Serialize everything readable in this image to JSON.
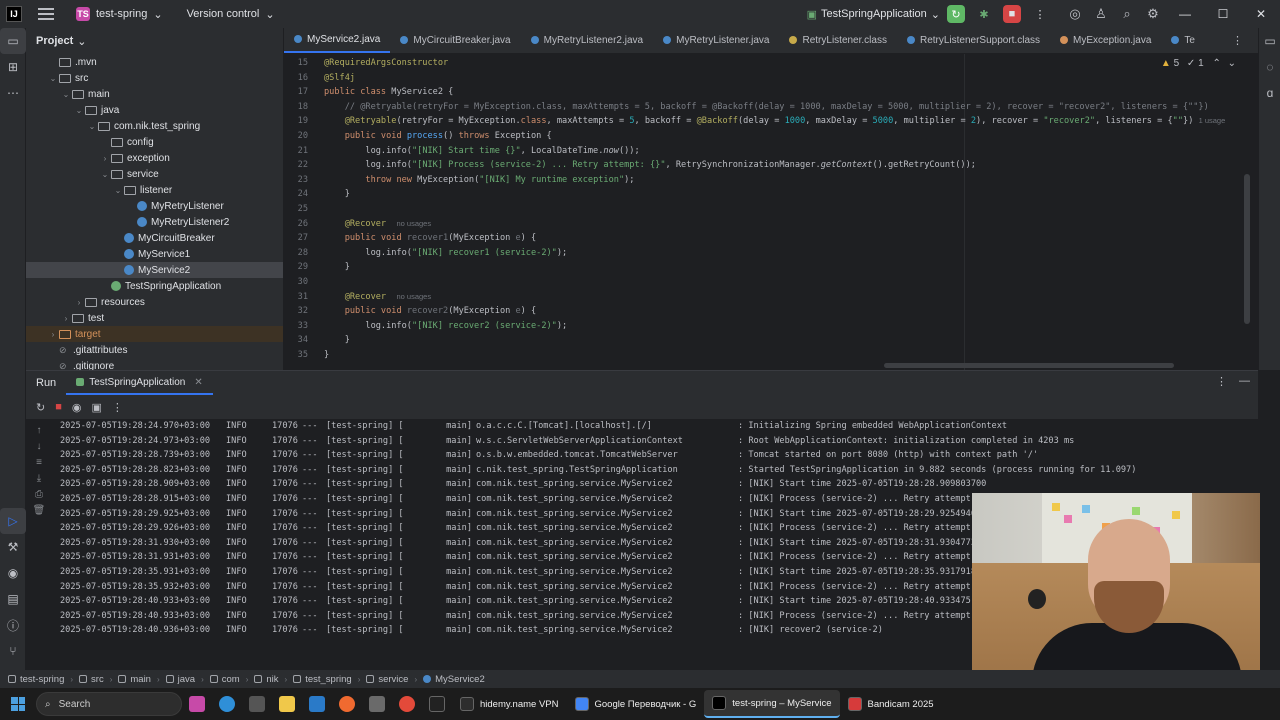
{
  "titlebar": {
    "logo": "IJ",
    "project_badge": "TS",
    "project_name": "test-spring",
    "vcs": "Version control",
    "run_config": "TestSpringApplication"
  },
  "project_panel": {
    "title": "Project",
    "items": [
      {
        "label": ".mvn",
        "indent": 1,
        "icon": "folder"
      },
      {
        "label": "src",
        "indent": 1,
        "icon": "folder",
        "expanded": true
      },
      {
        "label": "main",
        "indent": 2,
        "icon": "folder",
        "expanded": true
      },
      {
        "label": "java",
        "indent": 3,
        "icon": "folder",
        "expanded": true
      },
      {
        "label": "com.nik.test_spring",
        "indent": 4,
        "icon": "package",
        "expanded": true
      },
      {
        "label": "config",
        "indent": 5,
        "icon": "package"
      },
      {
        "label": "exception",
        "indent": 5,
        "icon": "package",
        "collapsed": true
      },
      {
        "label": "service",
        "indent": 5,
        "icon": "package",
        "expanded": true
      },
      {
        "label": "listener",
        "indent": 6,
        "icon": "package",
        "expanded": true
      },
      {
        "label": "MyRetryListener",
        "indent": 7,
        "icon": "class"
      },
      {
        "label": "MyRetryListener2",
        "indent": 7,
        "icon": "class"
      },
      {
        "label": "MyCircuitBreaker",
        "indent": 6,
        "icon": "class"
      },
      {
        "label": "MyService1",
        "indent": 6,
        "icon": "class"
      },
      {
        "label": "MyService2",
        "indent": 6,
        "icon": "class",
        "selected": true
      },
      {
        "label": "TestSpringApplication",
        "indent": 5,
        "icon": "spring"
      },
      {
        "label": "resources",
        "indent": 3,
        "icon": "folder",
        "collapsed": true
      },
      {
        "label": "test",
        "indent": 2,
        "icon": "folder",
        "collapsed": true
      },
      {
        "label": "target",
        "indent": 1,
        "icon": "folder-orange",
        "collapsed": true
      },
      {
        "label": ".gitattributes",
        "indent": 1,
        "icon": "file"
      },
      {
        "label": ".gitignore",
        "indent": 1,
        "icon": "file"
      }
    ]
  },
  "editor": {
    "tabs": [
      {
        "label": "MyService2.java",
        "active": true,
        "kind": "class"
      },
      {
        "label": "MyCircuitBreaker.java",
        "kind": "class"
      },
      {
        "label": "MyRetryListener2.java",
        "kind": "class"
      },
      {
        "label": "MyRetryListener.java",
        "kind": "class"
      },
      {
        "label": "RetryListener.class",
        "kind": "interface"
      },
      {
        "label": "RetryListenerSupport.class",
        "kind": "class"
      },
      {
        "label": "MyException.java",
        "kind": "exception"
      },
      {
        "label": "Te",
        "kind": "class"
      }
    ],
    "inspections": {
      "warnings": "5",
      "weak": "1"
    },
    "lines": [
      {
        "n": "15",
        "html": "<span class='ann'>@RequiredArgsConstructor</span>"
      },
      {
        "n": "16",
        "html": "<span class='ann'>@Slf4j</span>"
      },
      {
        "n": "17",
        "html": "<span class='kw'>public class</span> MyService2 {"
      },
      {
        "n": "18",
        "html": "    <span class='cmt'>// @Retryable(retryFor = MyException.class, maxAttempts = 5, backoff = @Backoff(delay = 1000, maxDelay = 5000, multiplier = 2), recover = \"recover2\", listeners = {\"\"})</span>"
      },
      {
        "n": "19",
        "html": "    <span class='ann'>@Retryable</span>(retryFor = MyException.<span class='kw'>class</span>, maxAttempts = <span class='num'>5</span>, backoff = <span class='ann'>@Backoff</span>(delay = <span class='num'>1000</span>, maxDelay = <span class='num'>5000</span>, multiplier = <span class='num'>2</span>), recover = <span class='str'>\"recover2\"</span>, listeners = {<span class='str'>\"\"</span>}) <span class='usage'>1 usage</span>"
      },
      {
        "n": "20",
        "html": "    <span class='kw'>public void</span> <span class='fn'>process</span>() <span class='kw'>throws</span> Exception {"
      },
      {
        "n": "21",
        "html": "        log.info(<span class='str'>\"[NIK] Start time {}\"</span>, LocalDateTime.<i>now</i>());"
      },
      {
        "n": "22",
        "html": "        log.info(<span class='str'>\"[NIK] Process (service-2) ... Retry attempt: {}\"</span>, RetrySynchronizationManager.<i>getContext</i>().getRetryCount());"
      },
      {
        "n": "23",
        "html": "        <span class='kw'>throw new</span> MyException(<span class='str'>\"[NIK] My runtime exception\"</span>);"
      },
      {
        "n": "24",
        "html": "    }"
      },
      {
        "n": "25",
        "html": ""
      },
      {
        "n": "26",
        "html": "    <span class='ann'>@Recover</span>  <span class='usage'>no usages</span>"
      },
      {
        "n": "27",
        "html": "    <span class='kw'>public void</span> <span class='grey'>recover1</span>(MyException <span class='grey'>e</span>) {"
      },
      {
        "n": "28",
        "html": "        log.info(<span class='str'>\"[NIK] recover1 (service-2)\"</span>);"
      },
      {
        "n": "29",
        "html": "    }"
      },
      {
        "n": "30",
        "html": ""
      },
      {
        "n": "31",
        "html": "    <span class='ann'>@Recover</span>  <span class='usage'>no usages</span>"
      },
      {
        "n": "32",
        "html": "    <span class='kw'>public void</span> <span class='grey'>recover2</span>(MyException <span class='grey'>e</span>) {"
      },
      {
        "n": "33",
        "html": "        log.info(<span class='str'>\"[NIK] recover2 (service-2)\"</span>);"
      },
      {
        "n": "34",
        "html": "    }"
      },
      {
        "n": "35",
        "html": "}"
      }
    ]
  },
  "run_panel": {
    "title": "Run",
    "tab": "TestSpringApplication",
    "logs": [
      {
        "ts": "2025-07-05T19:28:24.970+03:00",
        "lv": "INFO",
        "pid": "17076",
        "app": "[test-spring] [",
        "th": "main]",
        "lg": "o.a.c.c.C.[Tomcat].[localhost].[/]",
        "msg": ": Initializing Spring embedded WebApplicationContext"
      },
      {
        "ts": "2025-07-05T19:28:24.973+03:00",
        "lv": "INFO",
        "pid": "17076",
        "app": "[test-spring] [",
        "th": "main]",
        "lg": "w.s.c.ServletWebServerApplicationContext",
        "msg": ": Root WebApplicationContext: initialization completed in 4203 ms"
      },
      {
        "ts": "2025-07-05T19:28:28.739+03:00",
        "lv": "INFO",
        "pid": "17076",
        "app": "[test-spring] [",
        "th": "main]",
        "lg": "o.s.b.w.embedded.tomcat.TomcatWebServer",
        "msg": ": Tomcat started on port 8080 (http) with context path '/'"
      },
      {
        "ts": "2025-07-05T19:28:28.823+03:00",
        "lv": "INFO",
        "pid": "17076",
        "app": "[test-spring] [",
        "th": "main]",
        "lg": "c.nik.test_spring.TestSpringApplication",
        "msg": ": Started TestSpringApplication in 9.882 seconds (process running for 11.097)"
      },
      {
        "ts": "2025-07-05T19:28:28.909+03:00",
        "lv": "INFO",
        "pid": "17076",
        "app": "[test-spring] [",
        "th": "main]",
        "lg": "com.nik.test_spring.service.MyService2",
        "msg": ": [NIK] Start time 2025-07-05T19:28:28.909803700"
      },
      {
        "ts": "2025-07-05T19:28:28.915+03:00",
        "lv": "INFO",
        "pid": "17076",
        "app": "[test-spring] [",
        "th": "main]",
        "lg": "com.nik.test_spring.service.MyService2",
        "msg": ": [NIK] Process (service-2) ... Retry attempt: 0"
      },
      {
        "ts": "2025-07-05T19:28:29.925+03:00",
        "lv": "INFO",
        "pid": "17076",
        "app": "[test-spring] [",
        "th": "main]",
        "lg": "com.nik.test_spring.service.MyService2",
        "msg": ": [NIK] Start time 2025-07-05T19:28:29.925494600"
      },
      {
        "ts": "2025-07-05T19:28:29.926+03:00",
        "lv": "INFO",
        "pid": "17076",
        "app": "[test-spring] [",
        "th": "main]",
        "lg": "com.nik.test_spring.service.MyService2",
        "msg": ": [NIK] Process (service-2) ... Retry attempt: 1"
      },
      {
        "ts": "2025-07-05T19:28:31.930+03:00",
        "lv": "INFO",
        "pid": "17076",
        "app": "[test-spring] [",
        "th": "main]",
        "lg": "com.nik.test_spring.service.MyService2",
        "msg": ": [NIK] Start time 2025-07-05T19:28:31.930477300"
      },
      {
        "ts": "2025-07-05T19:28:31.931+03:00",
        "lv": "INFO",
        "pid": "17076",
        "app": "[test-spring] [",
        "th": "main]",
        "lg": "com.nik.test_spring.service.MyService2",
        "msg": ": [NIK] Process (service-2) ... Retry attempt: 2"
      },
      {
        "ts": "2025-07-05T19:28:35.931+03:00",
        "lv": "INFO",
        "pid": "17076",
        "app": "[test-spring] [",
        "th": "main]",
        "lg": "com.nik.test_spring.service.MyService2",
        "msg": ": [NIK] Start time 2025-07-05T19:28:35.931791800"
      },
      {
        "ts": "2025-07-05T19:28:35.932+03:00",
        "lv": "INFO",
        "pid": "17076",
        "app": "[test-spring] [",
        "th": "main]",
        "lg": "com.nik.test_spring.service.MyService2",
        "msg": ": [NIK] Process (service-2) ... Retry attempt: 3"
      },
      {
        "ts": "2025-07-05T19:28:40.933+03:00",
        "lv": "INFO",
        "pid": "17076",
        "app": "[test-spring] [",
        "th": "main]",
        "lg": "com.nik.test_spring.service.MyService2",
        "msg": ": [NIK] Start time 2025-07-05T19:28:40.933475"
      },
      {
        "ts": "2025-07-05T19:28:40.933+03:00",
        "lv": "INFO",
        "pid": "17076",
        "app": "[test-spring] [",
        "th": "main]",
        "lg": "com.nik.test_spring.service.MyService2",
        "msg": ": [NIK] Process (service-2) ... Retry attempt: 4"
      },
      {
        "ts": "2025-07-05T19:28:40.936+03:00",
        "lv": "INFO",
        "pid": "17076",
        "app": "[test-spring] [",
        "th": "main]",
        "lg": "com.nik.test_spring.service.MyService2",
        "msg": ": [NIK] recover2 (service-2)"
      }
    ]
  },
  "statusbar": {
    "crumbs": [
      "test-spring",
      "src",
      "main",
      "java",
      "com",
      "nik",
      "test_spring",
      "service",
      "MyService2"
    ]
  },
  "taskbar": {
    "search_placeholder": "Search",
    "apps": [
      {
        "label": "hidemy.name VPN",
        "color": "#2d2d2d"
      },
      {
        "label": "Google Переводчик - G",
        "color": "#4285f4"
      },
      {
        "label": "test-spring – MyService",
        "color": "#000000",
        "active": true
      },
      {
        "label": "Bandicam 2025",
        "color": "#d63b3b"
      }
    ],
    "tray": " "
  },
  "colors": {
    "accent": "#3574f0",
    "run_green": "#5fb865",
    "stop_red": "#d64545"
  }
}
